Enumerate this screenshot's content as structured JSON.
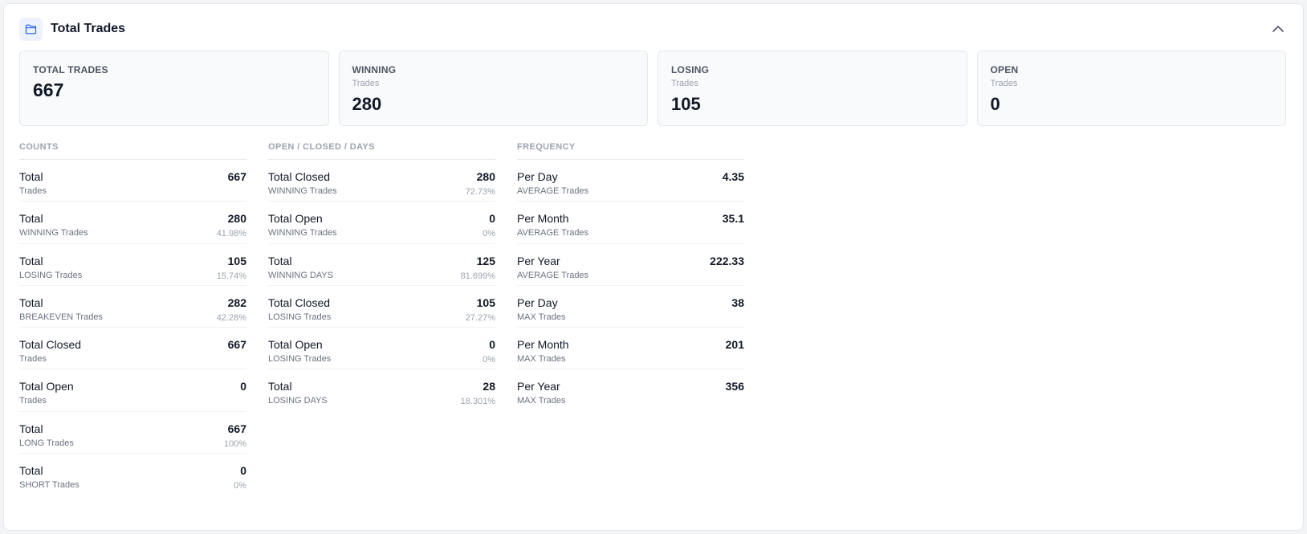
{
  "header": {
    "title": "Total Trades",
    "icon": "folder-icon"
  },
  "cards": [
    {
      "label": "TOTAL TRADES",
      "sub": "",
      "value": "667"
    },
    {
      "label": "WINNING",
      "sub": "Trades",
      "value": "280"
    },
    {
      "label": "LOSING",
      "sub": "Trades",
      "value": "105"
    },
    {
      "label": "OPEN",
      "sub": "Trades",
      "value": "0"
    }
  ],
  "counts": {
    "heading": "COUNTS",
    "rows": [
      {
        "label": "Total",
        "sub": "Trades",
        "value": "667",
        "pct": ""
      },
      {
        "label": "Total",
        "sub": "WINNING Trades",
        "value": "280",
        "pct": "41.98%"
      },
      {
        "label": "Total",
        "sub": "LOSING Trades",
        "value": "105",
        "pct": "15.74%"
      },
      {
        "label": "Total",
        "sub": "BREAKEVEN Trades",
        "value": "282",
        "pct": "42.28%"
      },
      {
        "label": "Total Closed",
        "sub": "Trades",
        "value": "667",
        "pct": ""
      },
      {
        "label": "Total Open",
        "sub": "Trades",
        "value": "0",
        "pct": ""
      },
      {
        "label": "Total",
        "sub": "LONG Trades",
        "value": "667",
        "pct": "100%"
      },
      {
        "label": "Total",
        "sub": "SHORT Trades",
        "value": "0",
        "pct": "0%"
      }
    ]
  },
  "open_closed": {
    "heading": "OPEN / CLOSED / DAYS",
    "rows": [
      {
        "label": "Total Closed",
        "sub": "WINNING Trades",
        "value": "280",
        "pct": "72.73%"
      },
      {
        "label": "Total Open",
        "sub": "WINNING Trades",
        "value": "0",
        "pct": "0%"
      },
      {
        "label": "Total",
        "sub": "WINNING DAYS",
        "value": "125",
        "pct": "81.699%"
      },
      {
        "label": "Total Closed",
        "sub": "LOSING Trades",
        "value": "105",
        "pct": "27.27%"
      },
      {
        "label": "Total Open",
        "sub": "LOSING Trades",
        "value": "0",
        "pct": "0%"
      },
      {
        "label": "Total",
        "sub": "LOSING DAYS",
        "value": "28",
        "pct": "18.301%"
      }
    ]
  },
  "frequency": {
    "heading": "FREQUENCY",
    "rows": [
      {
        "label": "Per Day",
        "sub": "AVERAGE Trades",
        "value": "4.35",
        "pct": ""
      },
      {
        "label": "Per Month",
        "sub": "AVERAGE Trades",
        "value": "35.1",
        "pct": ""
      },
      {
        "label": "Per Year",
        "sub": "AVERAGE Trades",
        "value": "222.33",
        "pct": ""
      },
      {
        "label": "Per Day",
        "sub": "MAX Trades",
        "value": "38",
        "pct": ""
      },
      {
        "label": "Per Month",
        "sub": "MAX Trades",
        "value": "201",
        "pct": ""
      },
      {
        "label": "Per Year",
        "sub": "MAX Trades",
        "value": "356",
        "pct": ""
      }
    ]
  }
}
